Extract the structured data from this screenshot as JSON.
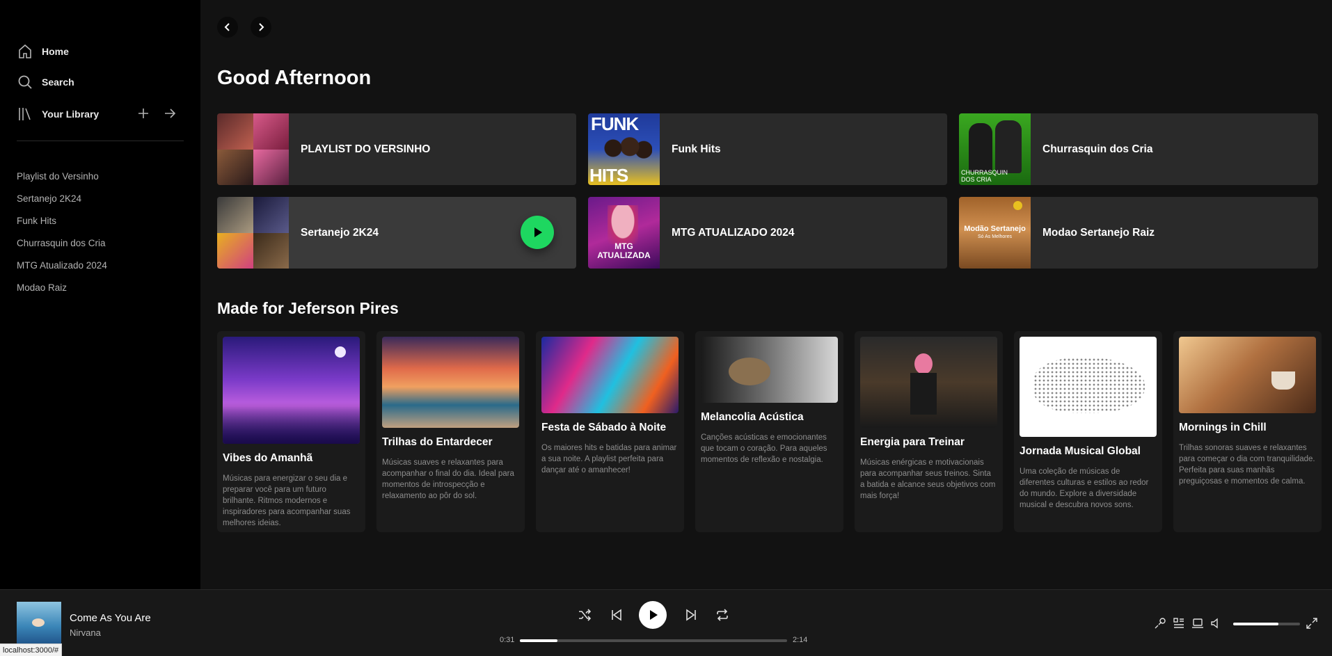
{
  "sidebar": {
    "nav": {
      "home": "Home",
      "search": "Search",
      "library": "Your Library"
    },
    "playlists": [
      "Playlist do Versinho",
      "Sertanejo 2K24",
      "Funk Hits",
      "Churrasquin dos Cria",
      "MTG Atualizado 2024",
      "Modao Raiz"
    ]
  },
  "main": {
    "greeting": "Good Afternoon",
    "quick": [
      {
        "title": "PLAYLIST DO VERSINHO"
      },
      {
        "title": "Funk Hits",
        "art_text_1": "FUNK",
        "art_text_2": "HITS"
      },
      {
        "title": "Churrasquin dos Cria",
        "art_text": "CHURRASQUIN DOS CRIA"
      },
      {
        "title": "Sertanejo 2K24"
      },
      {
        "title": "MTG ATUALIZADO 2024",
        "art_text": "MTG ATUALIZADA"
      },
      {
        "title": "Modao Sertanejo Raiz",
        "art_text": "Modão Sertanejo",
        "art_sub": "Só As Melhores"
      }
    ],
    "made_for_title": "Made for Jeferson Pires",
    "made_for": [
      {
        "title": "Vibes do Amanhã",
        "desc": "Músicas para energizar o seu dia e preparar você para um futuro brilhante. Ritmos modernos e inspiradores para acompanhar suas melhores ideias."
      },
      {
        "title": "Trilhas do Entardecer",
        "desc": "Músicas suaves e relaxantes para acompanhar o final do dia. Ideal para momentos de introspecção e relaxamento ao pôr do sol."
      },
      {
        "title": "Festa de Sábado à Noite",
        "desc": "Os maiores hits e batidas para animar a sua noite. A playlist perfeita para dançar até o amanhecer!"
      },
      {
        "title": "Melancolia Acústica",
        "desc": "Canções acústicas e emocionantes que tocam o coração. Para aqueles momentos de reflexão e nostalgia."
      },
      {
        "title": "Energia para Treinar",
        "desc": "Músicas enérgicas e motivacionais para acompanhar seus treinos. Sinta a batida e alcance seus objetivos com mais força!"
      },
      {
        "title": "Jornada Musical Global",
        "desc": "Uma coleção de músicas de diferentes culturas e estilos ao redor do mundo. Explore a diversidade musical e descubra novos sons."
      },
      {
        "title": "Mornings in Chill",
        "desc": "Trilhas sonoras suaves e relaxantes para começar o dia com tranquilidade. Perfeita para suas manhãs preguiçosas e momentos de calma."
      }
    ]
  },
  "player": {
    "track": "Come As You Are",
    "artist": "Nirvana",
    "elapsed": "0:31",
    "duration": "2:14",
    "progress_fraction": 0.14,
    "volume_fraction": 0.68
  },
  "status_url": "localhost:3000/#",
  "colors": {
    "accent": "#1ed760",
    "background": "#121212",
    "sidebar": "#000000"
  }
}
